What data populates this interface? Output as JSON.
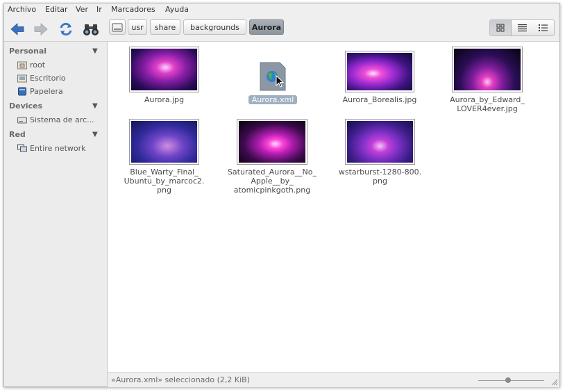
{
  "menu": [
    "Archivo",
    "Editar",
    "Ver",
    "Ir",
    "Marcadores",
    "Ayuda"
  ],
  "toolbar": {
    "back_icon": "back-arrow-icon",
    "forward_icon": "forward-arrow-icon",
    "reload_icon": "reload-icon",
    "search_icon": "binoculars-icon",
    "path_toggle_icon": "drive-icon",
    "breadcrumbs": [
      "usr",
      "share",
      "backgrounds",
      "Aurora"
    ],
    "view_modes": [
      "icon-view-icon",
      "list-view-icon",
      "compact-view-icon"
    ]
  },
  "sidebar": {
    "sections": [
      {
        "title": "Personal",
        "items": [
          "root",
          "Escritorio",
          "Papelera"
        ]
      },
      {
        "title": "Devices",
        "items": [
          "Sistema de arc..."
        ]
      },
      {
        "title": "Red",
        "items": [
          "Entire network"
        ]
      }
    ],
    "collapse_glyph": "▼"
  },
  "files": [
    {
      "name": "Aurora.jpg",
      "kind": "image",
      "selected": false
    },
    {
      "name": "Aurora.xml",
      "kind": "xml",
      "selected": true
    },
    {
      "name": "Aurora_Borealis.jpg",
      "kind": "image",
      "selected": false
    },
    {
      "name": "Aurora_by_Edward_\nLOVER4ever.jpg",
      "kind": "image",
      "selected": false
    },
    {
      "name": "Blue_Warty_Final_\nUbuntu_by_marcoc2.\npng",
      "kind": "image",
      "selected": false
    },
    {
      "name": "Saturated_Aurora__No_\nApple__by_\natomicpinkgoth.png",
      "kind": "image",
      "selected": false
    },
    {
      "name": "wstarburst-1280-800.\npng",
      "kind": "image",
      "selected": false
    }
  ],
  "status": {
    "text": "«Aurora.xml» seleccionado (2,2 KiB)",
    "zoom_level": 0.45
  },
  "colors": {
    "selection": "#9fb0c1",
    "accent_blue": "#3b76c4"
  }
}
